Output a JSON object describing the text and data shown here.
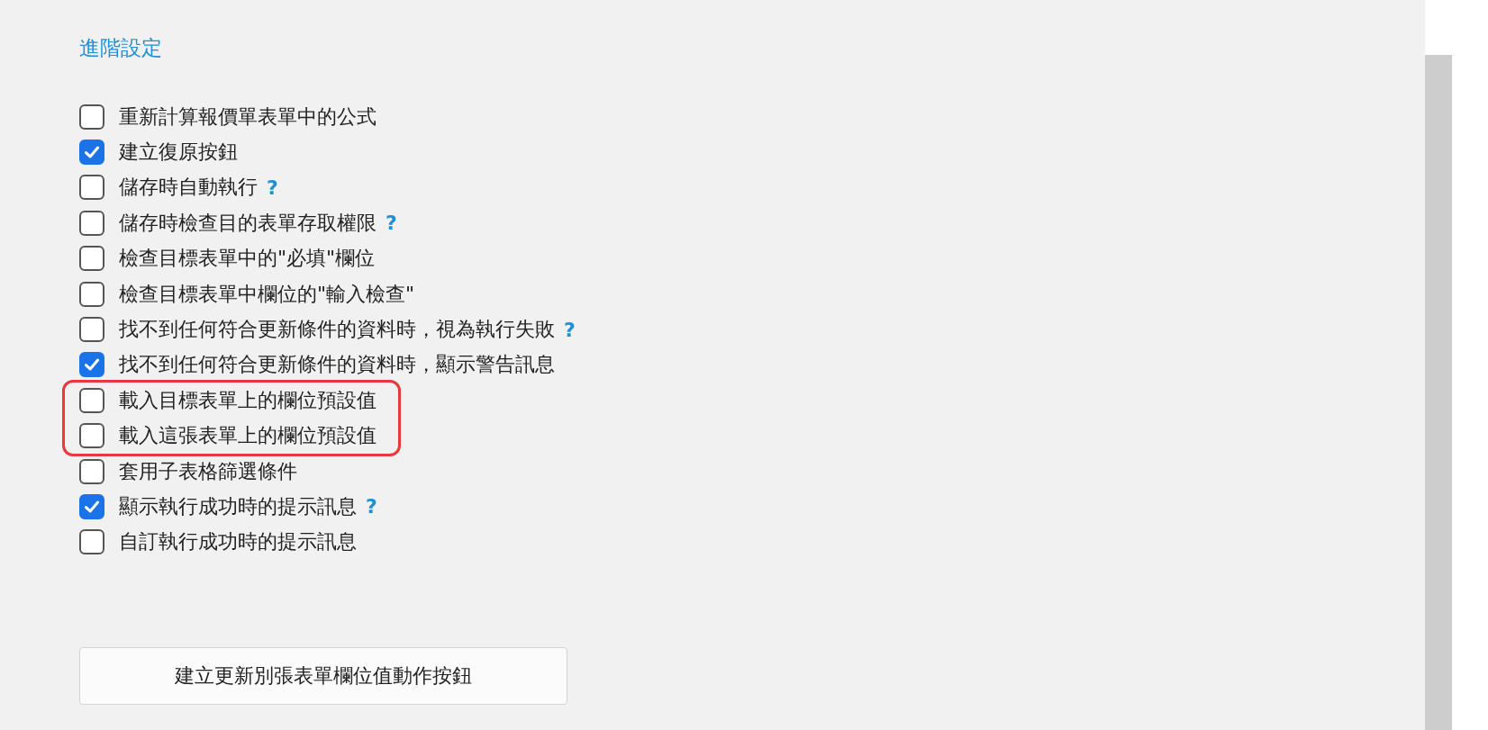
{
  "section_title": "進階設定",
  "options": [
    {
      "label": "重新計算報價單表單中的公式",
      "checked": false,
      "highlighted": false
    },
    {
      "label": "建立復原按鈕",
      "checked": true,
      "highlighted": false
    },
    {
      "label": "儲存時自動執行",
      "checked": false,
      "highlighted": false,
      "help": "?"
    },
    {
      "label": "儲存時檢查目的表單存取權限",
      "checked": false,
      "highlighted": false,
      "help": "?"
    },
    {
      "label": "檢查目標表單中的\"必填\"欄位",
      "checked": false,
      "highlighted": false
    },
    {
      "label": "檢查目標表單中欄位的\"輸入檢查\"",
      "checked": false,
      "highlighted": false
    },
    {
      "label": "找不到任何符合更新條件的資料時，視為執行失敗",
      "checked": false,
      "highlighted": false,
      "help": "?"
    },
    {
      "label": "找不到任何符合更新條件的資料時，顯示警告訊息",
      "checked": true,
      "highlighted": false
    },
    {
      "label": "載入目標表單上的欄位預設值",
      "checked": false,
      "highlighted": true
    },
    {
      "label": "載入這張表單上的欄位預設值",
      "checked": false,
      "highlighted": true
    },
    {
      "label": "套用子表格篩選條件",
      "checked": false,
      "highlighted": false
    },
    {
      "label": "顯示執行成功時的提示訊息",
      "checked": true,
      "highlighted": false,
      "help": "?"
    },
    {
      "label": "自訂執行成功時的提示訊息",
      "checked": false,
      "highlighted": false
    }
  ],
  "create_button": "建立更新別張表單欄位值動作按鈕"
}
